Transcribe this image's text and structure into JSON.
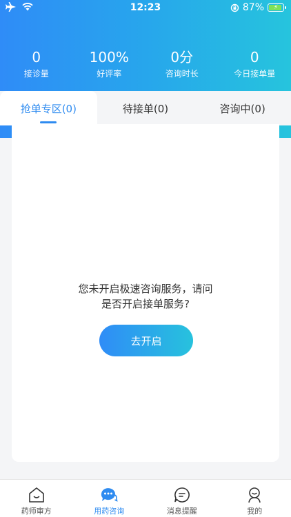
{
  "status_bar": {
    "time": "12:23",
    "battery_percent": "87%"
  },
  "stats": [
    {
      "value": "0",
      "label": "接诊量"
    },
    {
      "value": "100%",
      "label": "好评率"
    },
    {
      "value": "0分",
      "label": "咨询时长"
    },
    {
      "value": "0",
      "label": "今日接单量"
    }
  ],
  "tabs": [
    {
      "label": "抢单专区(0)",
      "active": true
    },
    {
      "label": "待接单(0)",
      "active": false
    },
    {
      "label": "咨询中(0)",
      "active": false
    }
  ],
  "content": {
    "message_line1": "您未开启极速咨询服务，请问",
    "message_line2": "是否开启接单服务?",
    "button_label": "去开启"
  },
  "bottom_nav": [
    {
      "label": "药师审方",
      "icon": "home-icon",
      "active": false
    },
    {
      "label": "用药咨询",
      "icon": "chat-bubble-icon",
      "active": true
    },
    {
      "label": "消息提醒",
      "icon": "message-icon",
      "active": false
    },
    {
      "label": "我的",
      "icon": "user-icon",
      "active": false
    }
  ],
  "colors": {
    "accent": "#2e8bf0",
    "gradient_start": "#2f8cf7",
    "gradient_end": "#26c4dd"
  }
}
